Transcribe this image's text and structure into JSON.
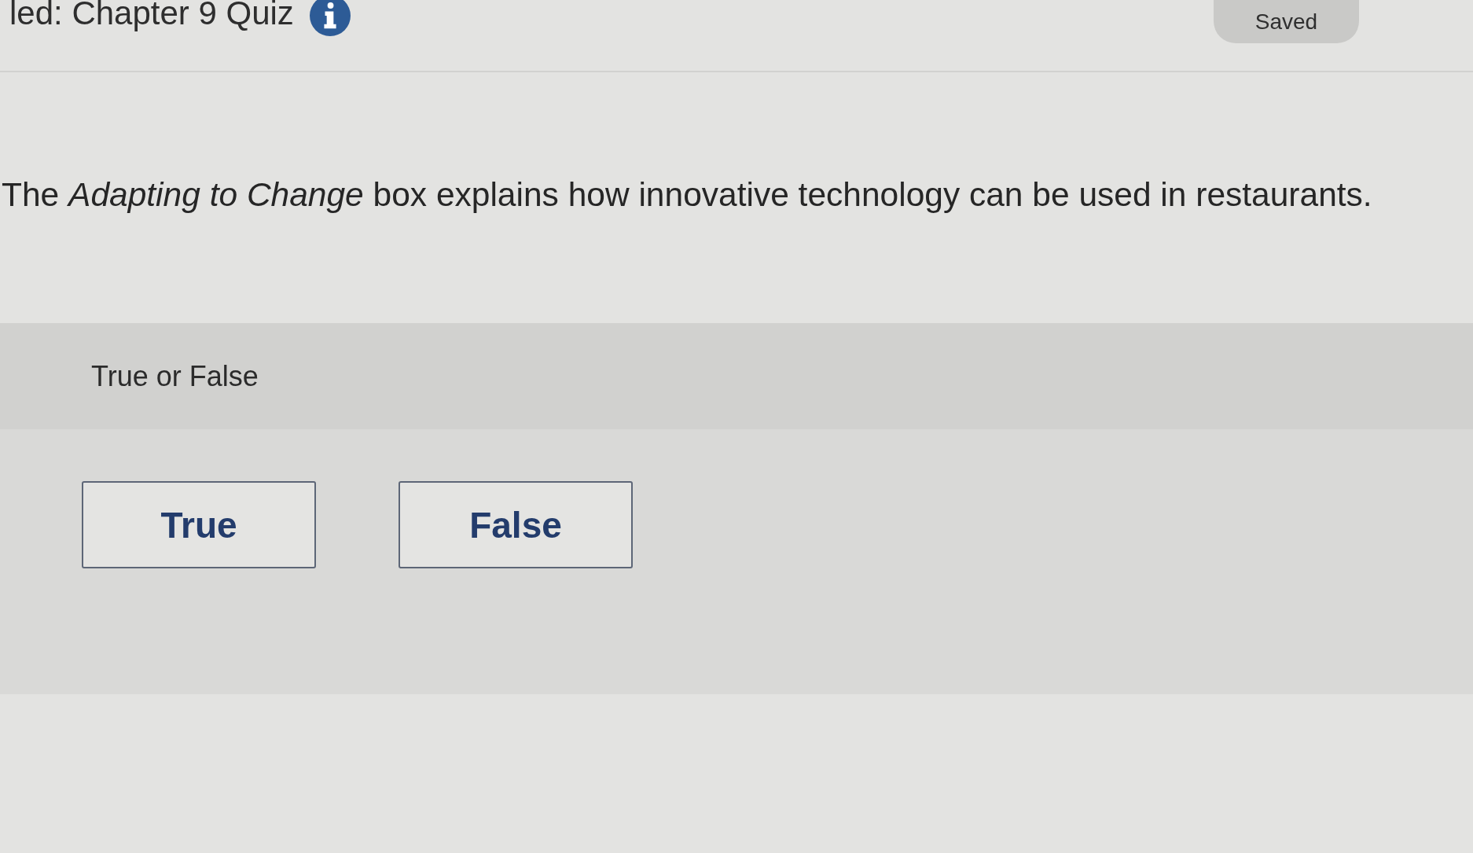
{
  "header": {
    "title": "led: Chapter 9 Quiz",
    "status": "Saved"
  },
  "question": {
    "prompt": "The *Adapting to Change* box explains how innovative technology can be used in restaurants.",
    "type_label": "True or False",
    "choices": [
      {
        "label": "True",
        "selected": false
      },
      {
        "label": "False",
        "selected": false
      }
    ]
  }
}
